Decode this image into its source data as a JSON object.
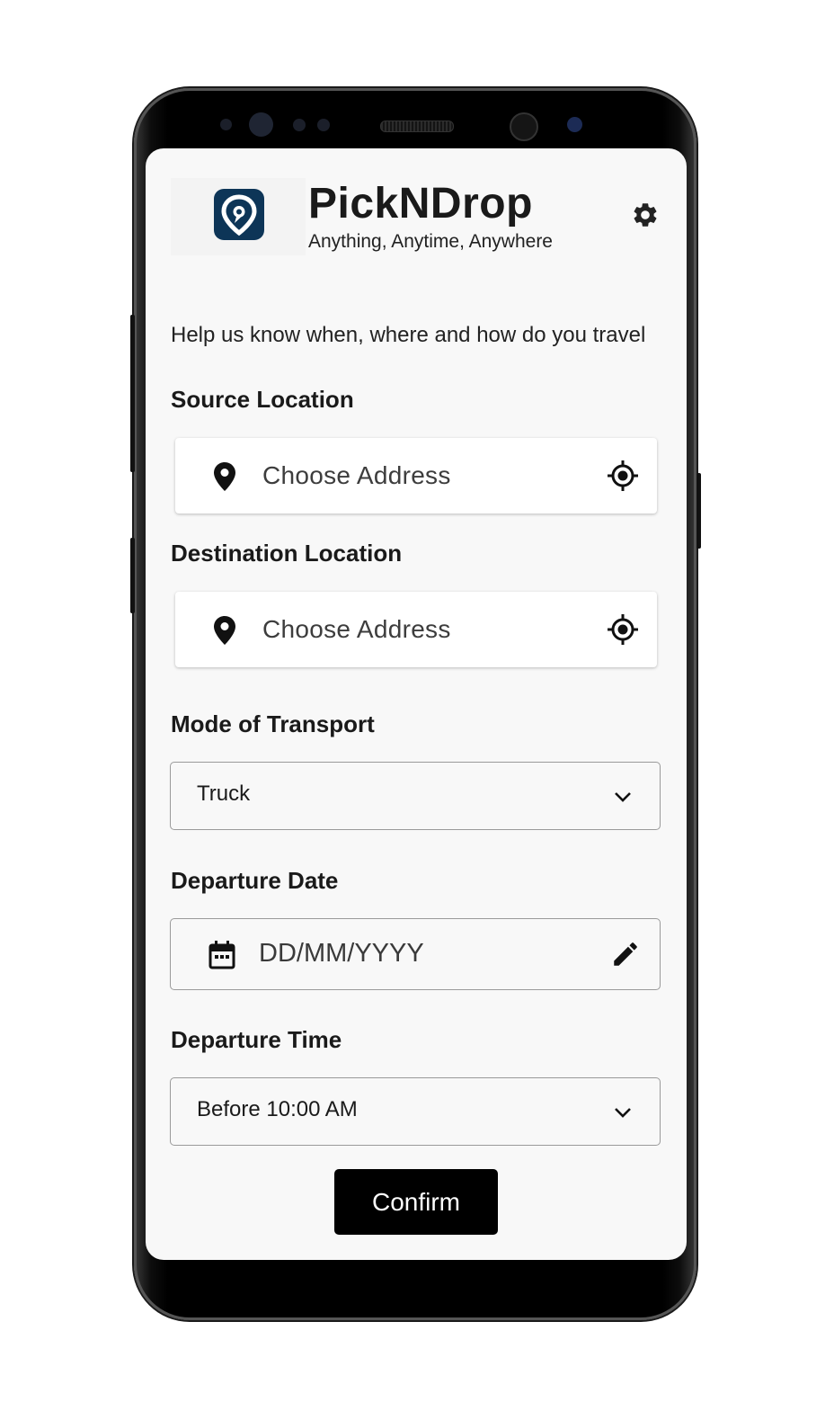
{
  "app": {
    "title": "PickNDrop",
    "tagline": "Anything, Anytime, Anywhere"
  },
  "form": {
    "intro": "Help us know when, where and how do you travel",
    "source": {
      "label": "Source Location",
      "placeholder": "Choose Address"
    },
    "destination": {
      "label": "Destination Location",
      "placeholder": "Choose Address"
    },
    "transport": {
      "label": "Mode of Transport",
      "value": "Truck"
    },
    "date": {
      "label": "Departure Date",
      "placeholder": "DD/MM/YYYY"
    },
    "time": {
      "label": "Departure Time",
      "value": "Before 10:00 AM"
    },
    "confirm_label": "Confirm"
  },
  "icons": {
    "logo": "location-pin-logo",
    "settings": "gear-icon",
    "pin": "map-pin-icon",
    "locate": "gps-target-icon",
    "dropdown": "chevron-down-icon",
    "calendar": "calendar-icon",
    "edit": "pencil-icon"
  },
  "colors": {
    "brand": "#0d3557",
    "button_bg": "#000000",
    "screen_bg": "#f8f8f8"
  }
}
